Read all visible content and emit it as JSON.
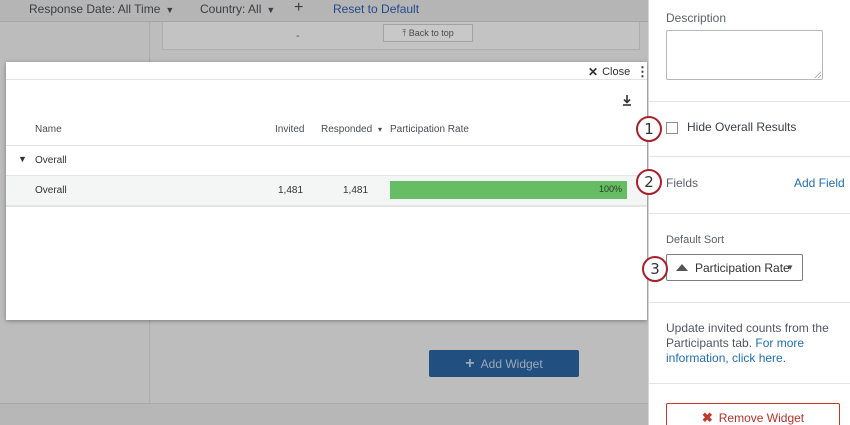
{
  "filters": {
    "response_date": "Response Date: All Time",
    "country": "Country: All",
    "add": "+",
    "reset": "Reset to Default"
  },
  "background": {
    "widget_dash": "-",
    "back_to_top": "⤒ Back to top",
    "add_widget": "Add Widget"
  },
  "modal": {
    "close_label": "Close",
    "columns": {
      "name": "Name",
      "invited": "Invited",
      "responded": "Responded",
      "sort_arrow": "▾",
      "participation_rate": "Participation Rate"
    },
    "group": {
      "label": "Overall"
    },
    "rows": [
      {
        "name": "Overall",
        "invited": "1,481",
        "responded": "1,481",
        "rate_label": "100%",
        "rate": 1.0
      }
    ]
  },
  "pane": {
    "description_label": "Description",
    "description_value": "",
    "hide_overall_label": "Hide Overall Results",
    "hide_overall_checked": false,
    "fields_label": "Fields",
    "add_field": "Add Field",
    "default_sort_label": "Default Sort",
    "default_sort_value": "Participation Rate",
    "info_text": "Update invited counts from the Participants tab.",
    "info_link": "For more information, click here.",
    "remove_widget": "Remove Widget"
  },
  "callouts": [
    "1",
    "2",
    "3"
  ],
  "colors": {
    "bar": "#66bd63",
    "link": "#1f6fb4",
    "callout_ring": "#a8202c",
    "primary_button": "#214f7f",
    "remove": "#c0392b"
  },
  "icons": [
    "chevron-down-icon",
    "plus-icon",
    "close-icon",
    "kebab-menu-icon",
    "download-icon",
    "sort-ascending-icon",
    "remove-x-icon"
  ]
}
